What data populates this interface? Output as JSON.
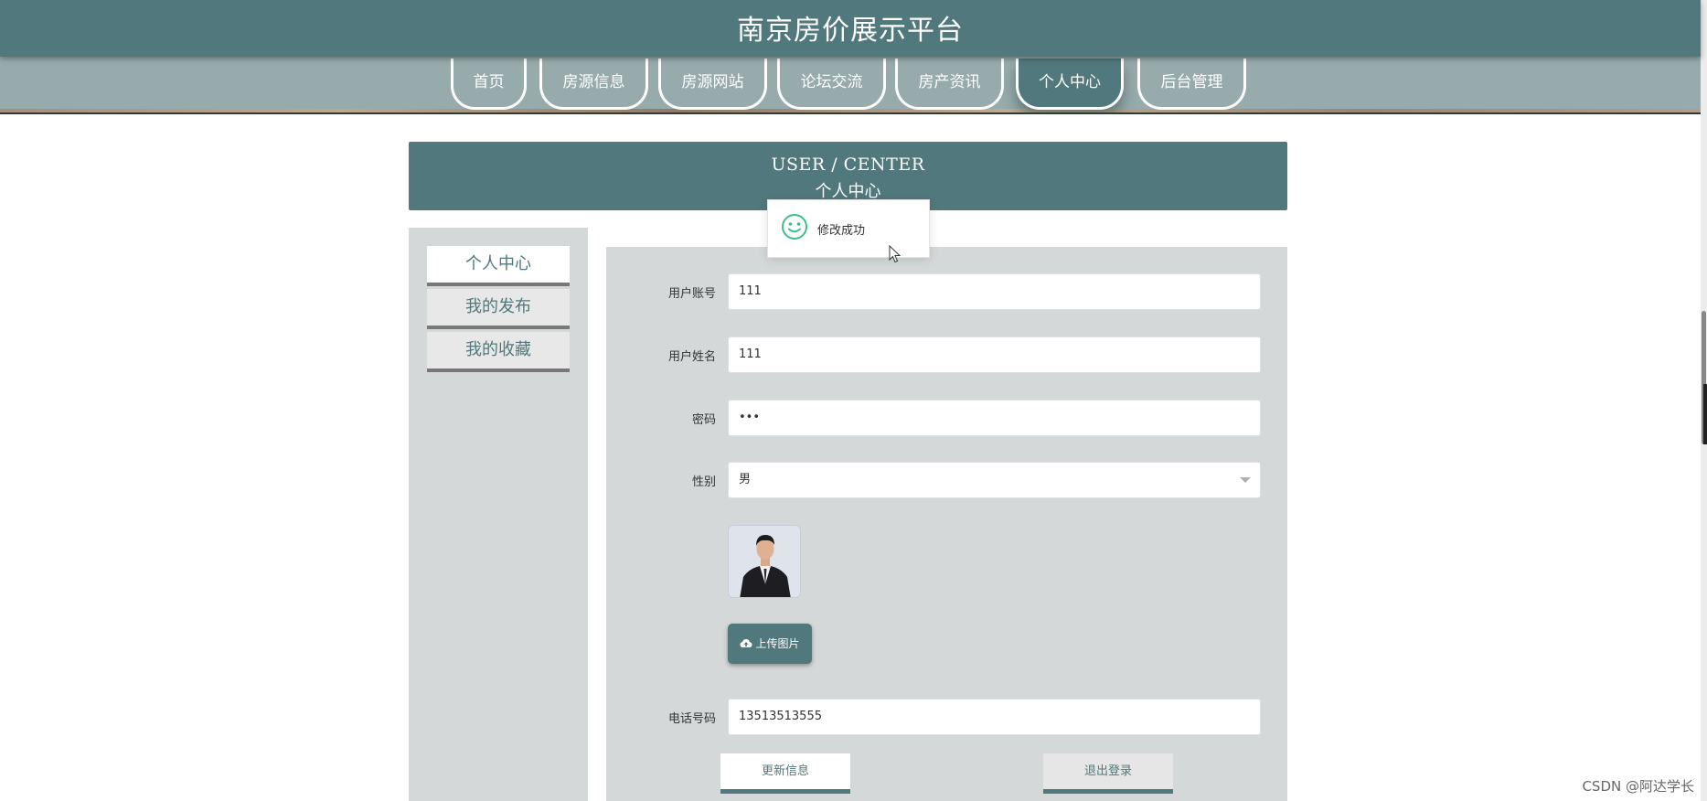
{
  "header": {
    "site_title": "南京房价展示平台"
  },
  "nav": {
    "items": [
      {
        "label": "首页"
      },
      {
        "label": "房源信息"
      },
      {
        "label": "房源网站"
      },
      {
        "label": "论坛交流"
      },
      {
        "label": "房产资讯"
      },
      {
        "label": "个人中心",
        "active": true
      },
      {
        "label": "后台管理"
      }
    ]
  },
  "banner": {
    "title_en": "USER / CENTER",
    "title_cn": "个人中心"
  },
  "toast": {
    "message": "修改成功",
    "icon": "smile-icon",
    "color": "#3cc08a"
  },
  "sidebar": {
    "items": [
      {
        "label": "个人中心",
        "active": true
      },
      {
        "label": "我的发布"
      },
      {
        "label": "我的收藏"
      }
    ]
  },
  "form": {
    "account": {
      "label": "用户账号",
      "value": "111"
    },
    "name": {
      "label": "用户姓名",
      "value": "111"
    },
    "password": {
      "label": "密码",
      "value": "•••"
    },
    "gender": {
      "label": "性别",
      "value": "男"
    },
    "upload_label": "上传图片",
    "phone": {
      "label": "电话号码",
      "value": "13513513555"
    },
    "update_label": "更新信息",
    "logout_label": "退出登录"
  },
  "colors": {
    "primary": "#51787c",
    "nav_band": "#97aaac",
    "panel": "#d4d8d8"
  },
  "watermark": "CSDN @阿达学长"
}
